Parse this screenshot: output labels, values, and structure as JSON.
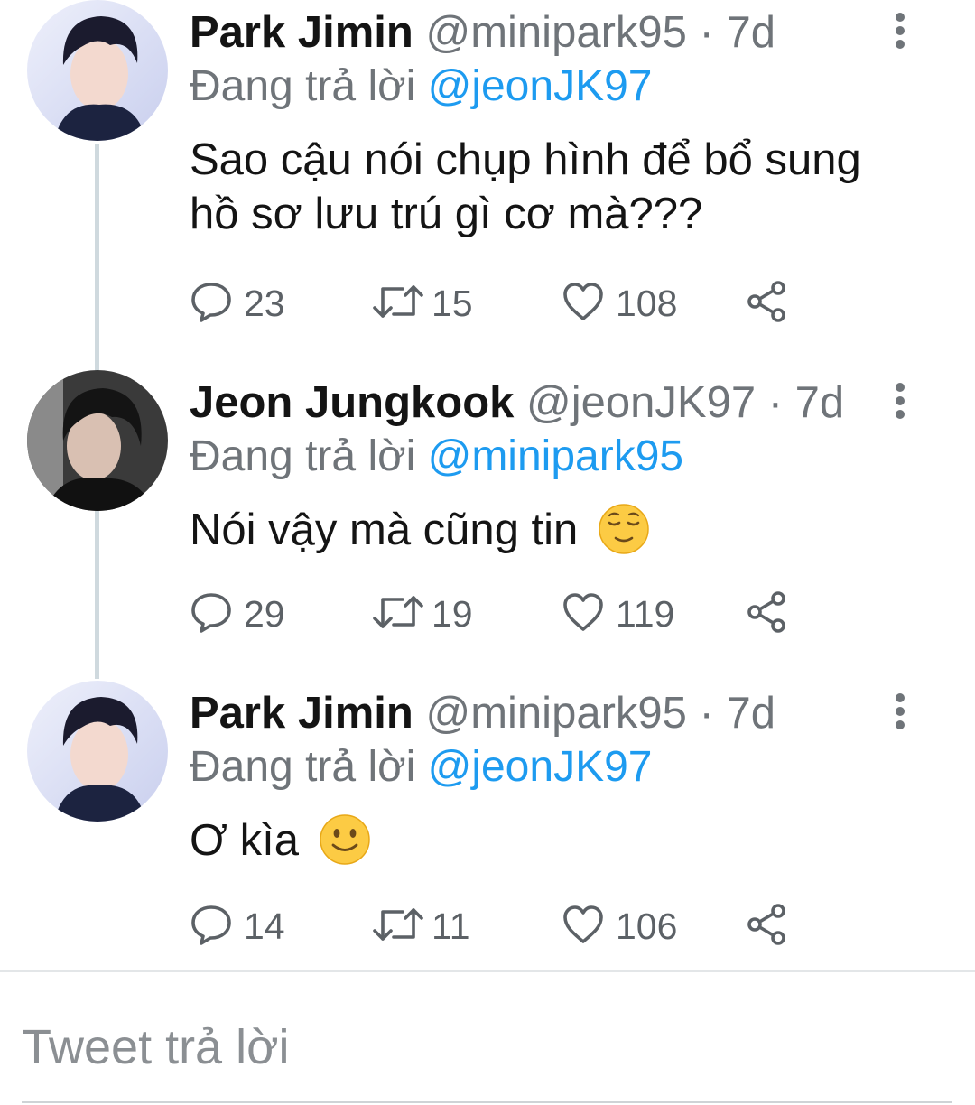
{
  "tweets": [
    {
      "name": "Park Jimin",
      "handle": "@minipark95",
      "separator": "·",
      "time": "7d",
      "replying_prefix": "Đang trả lời",
      "replying_to": "@jeonJK97",
      "text_lines": [
        "Sao cậu nói chụp hình để bổ sung",
        "hồ sơ lưu trú gì cơ mà???"
      ],
      "emoji": "",
      "replies": "23",
      "retweets": "15",
      "likes": "108"
    },
    {
      "name": "Jeon Jungkook",
      "handle": "@jeonJK97",
      "separator": "·",
      "time": "7d",
      "replying_prefix": "Đang trả lời",
      "replying_to": "@minipark95",
      "text_lines": [
        "Nói vậy mà cũng tin"
      ],
      "emoji": "relieved-face",
      "replies": "29",
      "retweets": "19",
      "likes": "119"
    },
    {
      "name": "Park Jimin",
      "handle": "@minipark95",
      "separator": "·",
      "time": "7d",
      "replying_prefix": "Đang trả lời",
      "replying_to": "@jeonJK97",
      "text_lines": [
        "Ơ kìa"
      ],
      "emoji": "slightly-smiling-face",
      "replies": "14",
      "retweets": "11",
      "likes": "106"
    }
  ],
  "icons": {
    "reply": "speech-bubble-icon",
    "retweet": "retweet-icon",
    "like": "heart-icon",
    "share": "share-icon",
    "more": "more-vertical-icon"
  },
  "colors": {
    "link": "#1d9bf0",
    "secondary_text": "#6f7479",
    "thread_line": "#cfd9de"
  },
  "compose": {
    "placeholder": "Tweet trả lời"
  }
}
